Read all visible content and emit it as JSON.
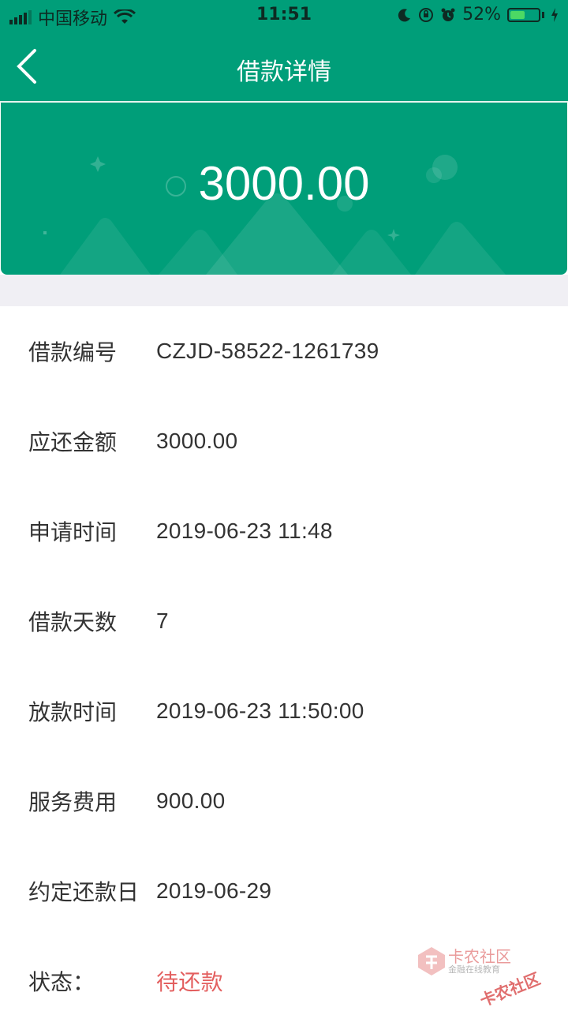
{
  "status_bar": {
    "carrier": "中国移动",
    "time": "11:51",
    "battery_percent": "52%",
    "battery_level": 0.52
  },
  "nav": {
    "title": "借款详情",
    "back_icon": "chevron-left-icon"
  },
  "hero": {
    "amount": "3000.00"
  },
  "details": [
    {
      "label": "借款编号",
      "value": "CZJD-58522-1261739"
    },
    {
      "label": "应还金额",
      "value": "3000.00"
    },
    {
      "label": "申请时间",
      "value": "2019-06-23 11:48"
    },
    {
      "label": "借款天数",
      "value": "7"
    },
    {
      "label": "放款时间",
      "value": "2019-06-23 11:50:00"
    },
    {
      "label": "服务费用",
      "value": "900.00"
    },
    {
      "label": "约定还款日",
      "value": "2019-06-29"
    },
    {
      "label": "状态：",
      "value": "待还款"
    }
  ],
  "watermark": {
    "name": "卡农社区",
    "tagline": "金融在线教育",
    "stamp": "卡农社区"
  },
  "colors": {
    "primary": "#009e79",
    "status_pending": "#e35f5f",
    "background_gap": "#f0eff4"
  }
}
